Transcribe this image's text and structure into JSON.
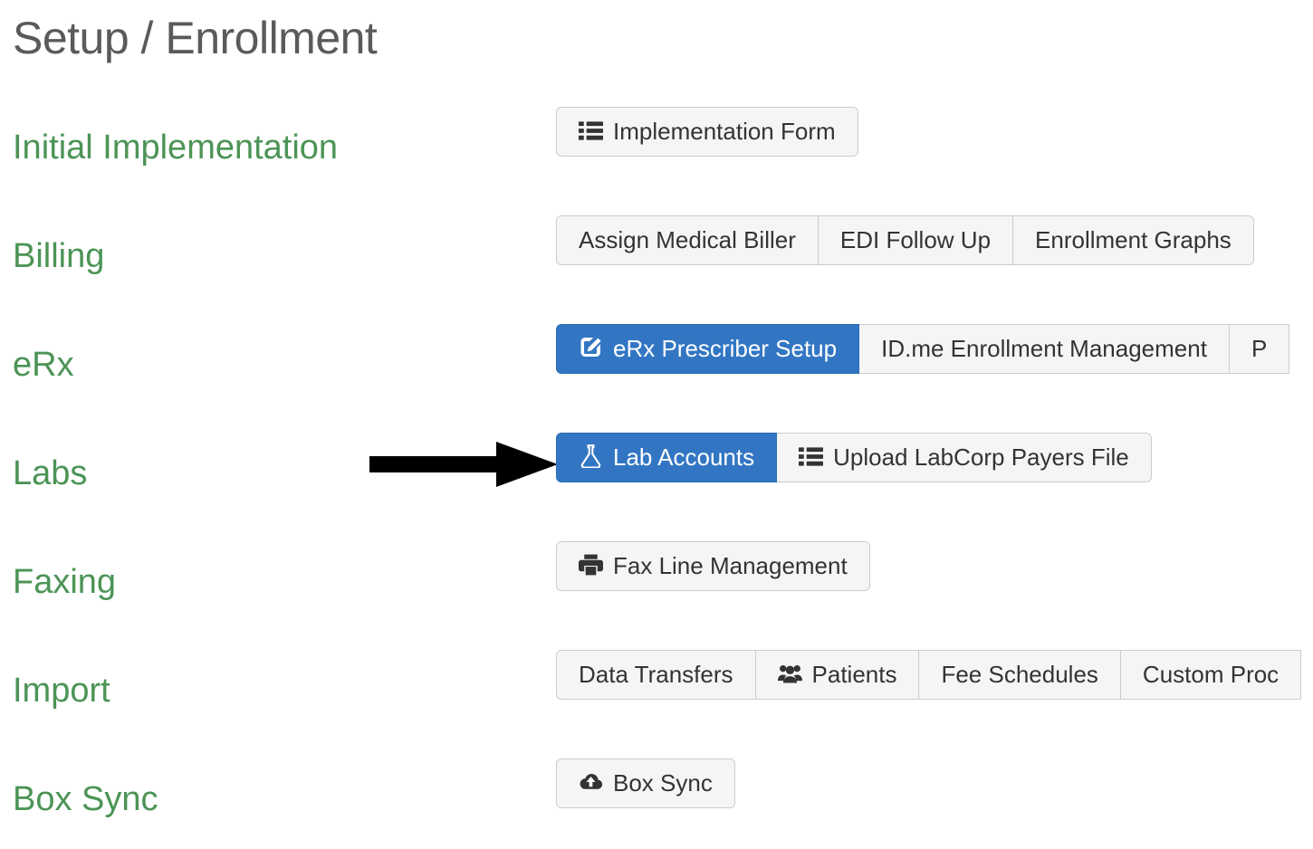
{
  "page": {
    "title": "Setup / Enrollment",
    "title_color": "#5a5a5a",
    "section_label_color": "#4c9456",
    "primary_button_color": "#3276c3",
    "button_face_color": "#f5f5f5",
    "button_border_color": "#cccccc"
  },
  "annotation": {
    "type": "arrow",
    "direction": "right",
    "color": "#000000",
    "points_to": "Lab Accounts"
  },
  "sections": [
    {
      "label": "Initial Implementation",
      "buttons": [
        {
          "label": "Implementation Form",
          "icon": "list-icon",
          "state": "default",
          "clipped": false
        }
      ]
    },
    {
      "label": "Billing",
      "buttons": [
        {
          "label": "Assign Medical Biller",
          "icon": "",
          "state": "default",
          "clipped": false
        },
        {
          "label": "EDI Follow Up",
          "icon": "",
          "state": "default",
          "clipped": false
        },
        {
          "label": "Enrollment Graphs",
          "icon": "",
          "state": "default",
          "clipped": false
        }
      ]
    },
    {
      "label": "eRx",
      "buttons": [
        {
          "label": "eRx Prescriber Setup",
          "icon": "edit-pencil-square-icon",
          "state": "active",
          "clipped": false
        },
        {
          "label": "ID.me Enrollment Management",
          "icon": "",
          "state": "default",
          "clipped": false
        },
        {
          "label": "P",
          "icon": "",
          "state": "default",
          "clipped": true
        }
      ]
    },
    {
      "label": "Labs",
      "buttons": [
        {
          "label": "Lab Accounts",
          "icon": "flask-icon",
          "state": "active",
          "clipped": false
        },
        {
          "label": "Upload LabCorp Payers File",
          "icon": "list-icon",
          "state": "default",
          "clipped": false
        }
      ]
    },
    {
      "label": "Faxing",
      "buttons": [
        {
          "label": "Fax Line Management",
          "icon": "printer-fax-icon",
          "state": "default",
          "clipped": false
        }
      ]
    },
    {
      "label": "Import",
      "buttons": [
        {
          "label": "Data Transfers",
          "icon": "",
          "state": "default",
          "clipped": false
        },
        {
          "label": "Patients",
          "icon": "users-icon",
          "state": "default",
          "clipped": false
        },
        {
          "label": "Fee Schedules",
          "icon": "",
          "state": "default",
          "clipped": false
        },
        {
          "label": "Custom Proc",
          "icon": "",
          "state": "default",
          "clipped": true
        }
      ]
    },
    {
      "label": "Box Sync",
      "buttons": [
        {
          "label": "Box Sync",
          "icon": "cloud-upload-icon",
          "state": "default",
          "clipped": false
        }
      ]
    }
  ]
}
